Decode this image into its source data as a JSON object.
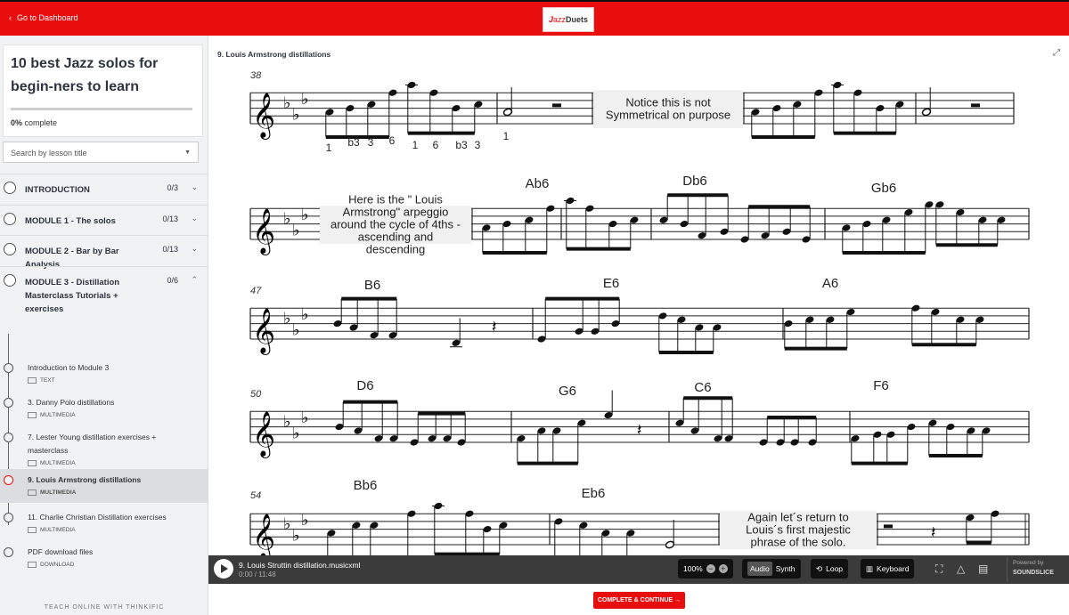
{
  "topbar": {
    "back_label": "Go to Dashboard",
    "logo_text": "JazzDuets"
  },
  "sidebar": {
    "course_title": "10 best Jazz solos for begin-ners to learn",
    "progress": {
      "percent": 0,
      "label_bold": "0%",
      "label": " complete"
    },
    "search_placeholder": "Search by lesson title",
    "modules": [
      {
        "title": "INTRODUCTION",
        "count": "0/3",
        "expanded": false
      },
      {
        "title": "MODULE 1 - The solos",
        "count": "0/13",
        "expanded": false
      },
      {
        "title": "MODULE 2 - Bar by Bar Analysis",
        "count": "0/13",
        "expanded": false
      },
      {
        "title": "MODULE 3 - Distillation Masterclass Tutorials + exercises",
        "count": "0/6",
        "expanded": true
      }
    ],
    "lessons": [
      {
        "title": "Introduction to Module 3",
        "type": "TEXT"
      },
      {
        "title": "3. Danny Polo distillations",
        "type": "MULTIMEDIA"
      },
      {
        "title": "7. Lester Young distillation exercises + masterclass",
        "type": "MULTIMEDIA"
      },
      {
        "title": "9. Louis Armstrong distillations",
        "type": "MULTIMEDIA",
        "active": true
      },
      {
        "title": "11. Charlie Christian Distillation exercises",
        "type": "MULTIMEDIA"
      },
      {
        "title": "PDF download files",
        "type": "DOWNLOAD"
      }
    ],
    "footer": "TEACH ONLINE WITH THINKIFIC"
  },
  "main": {
    "lesson_title": "9. Louis Armstrong distillations",
    "score": {
      "measure_numbers": [
        "38",
        "47",
        "50",
        "54"
      ],
      "fingerings": [
        "1",
        "b3",
        "3",
        "6",
        "1",
        "6",
        "b3",
        "3",
        "1"
      ],
      "chords": [
        "Ab6",
        "Db6",
        "Gb6",
        "B6",
        "E6",
        "A6",
        "D6",
        "G6",
        "C6",
        "F6",
        "Bb6",
        "Eb6"
      ],
      "annotations": [
        [
          "Notice this is not",
          "Symmetrical on purpose"
        ],
        [
          "Here is the \" Louis",
          "Armstrong\" arpeggio",
          "around the cycle of 4ths -",
          "ascending and",
          "descending"
        ],
        [
          "Again let´s return to",
          "Louis´s first majestic",
          "phrase of the solo."
        ]
      ]
    }
  },
  "player": {
    "file": "9. Louis Struttin distillation.musicxml",
    "time": "0:00 / 11:48",
    "zoom": "100%",
    "audio": "Audio",
    "synth": "Synth",
    "loop": "Loop",
    "keyboard": "Keyboard",
    "powered_by": "Powered by",
    "brand": "SOUNDSLICE"
  },
  "footer": {
    "complete_label": "COMPLETE & CONTINUE →"
  },
  "colors": {
    "brand_red": "#e90e0e",
    "player_bg": "#3b3b3b"
  }
}
